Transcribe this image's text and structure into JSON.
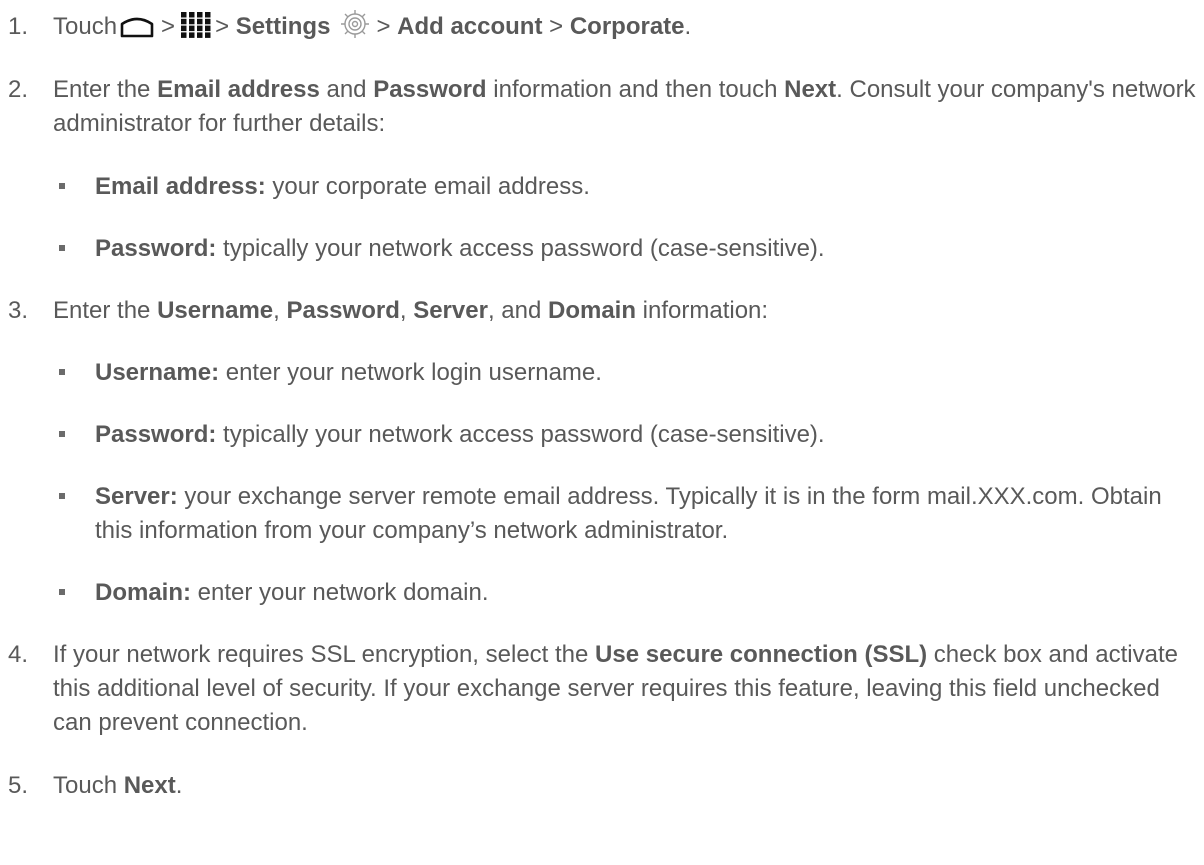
{
  "steps": [
    {
      "number": "1.",
      "prefix": "Touch",
      "sep1": ">",
      "sep2": ">",
      "settings_label": "Settings",
      "sep3": ">",
      "add_account_label": "Add account",
      "sep4": ">",
      "corporate_label": "Corporate",
      "end": ".",
      "icons": [
        "home-icon",
        "apps-icon",
        "gear-icon"
      ]
    },
    {
      "number": "2.",
      "t1": "Enter the ",
      "email_label": "Email address",
      "t2": " and ",
      "password_label": "Password",
      "t3": " information and then touch ",
      "next_label": "Next",
      "t4": ". Consult your company's network administrator for further details:",
      "bullets": [
        {
          "label": "Email address:",
          "text": " your corporate email address."
        },
        {
          "label": "Password:",
          "text": " typically your network access password (case-sensitive)."
        }
      ]
    },
    {
      "number": "3.",
      "t1": "Enter the ",
      "username_label": "Username",
      "c1": ", ",
      "password_label": "Password",
      "c2": ", ",
      "server_label": "Server",
      "c3": ", and ",
      "domain_label": "Domain",
      "t2": " information:",
      "bullets": [
        {
          "label": "Username:",
          "text": " enter your network login username."
        },
        {
          "label": "Password:",
          "text": " typically your network access password (case-sensitive)."
        },
        {
          "label": "Server:",
          "text": " your exchange server remote email address. Typically it is in the form mail.XXX.com. Obtain this information from your company’s network administrator."
        },
        {
          "label": "Domain:",
          "text": " enter your network domain."
        }
      ]
    },
    {
      "number": "4.",
      "t1": "If your network requires SSL encryption, select the ",
      "ssl_label": "Use secure connection (SSL)",
      "t2": " check box and activate this additional level of security. If your exchange server requires this feature, leaving this field unchecked can prevent connection."
    },
    {
      "number": "5.",
      "t1": "Touch ",
      "next_label": "Next",
      "end": "."
    }
  ],
  "colors": {
    "text": "#595959",
    "bullet": "#6b6b6b",
    "icon_dark": "#111111"
  }
}
